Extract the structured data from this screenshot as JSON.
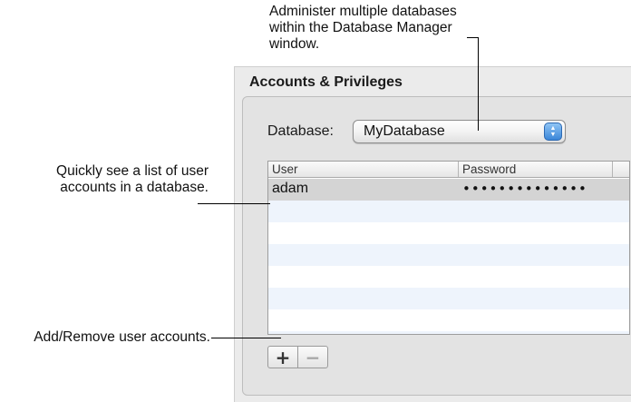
{
  "callouts": {
    "top_line1": "Administer multiple databases",
    "top_line2": "within the Database Manager",
    "top_line3": "window.",
    "left1_line1": "Quickly see a list of user",
    "left1_line2": "accounts in a database.",
    "left2": "Add/Remove user accounts."
  },
  "panel": {
    "title": "Accounts & Privileges",
    "database_label": "Database:",
    "database_value": "MyDatabase",
    "table": {
      "columns": [
        "User",
        "Password"
      ],
      "rows": [
        {
          "user": "adam",
          "password": "••••••••••••••"
        }
      ]
    },
    "add_label": "+",
    "remove_label": "−"
  }
}
